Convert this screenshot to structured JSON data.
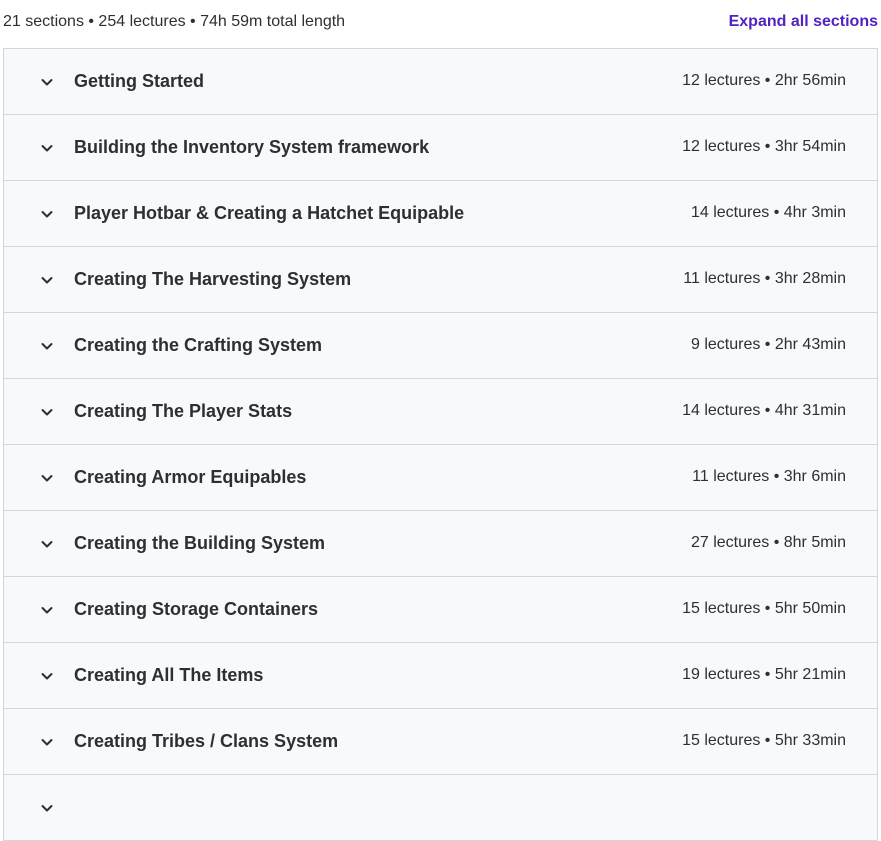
{
  "header": {
    "summary": "21 sections • 254 lectures • 74h 59m total length",
    "expand_all_label": "Expand all sections"
  },
  "sections": [
    {
      "title": "Getting Started",
      "meta": "12 lectures • 2hr 56min"
    },
    {
      "title": "Building the Inventory System framework",
      "meta": "12 lectures • 3hr 54min"
    },
    {
      "title": "Player Hotbar & Creating a Hatchet Equipable",
      "meta": "14 lectures • 4hr 3min"
    },
    {
      "title": "Creating The Harvesting System",
      "meta": "11 lectures • 3hr 28min"
    },
    {
      "title": "Creating the Crafting System",
      "meta": "9 lectures • 2hr 43min"
    },
    {
      "title": "Creating The Player Stats",
      "meta": "14 lectures • 4hr 31min"
    },
    {
      "title": "Creating Armor Equipables",
      "meta": "11 lectures • 3hr 6min"
    },
    {
      "title": "Creating the Building System",
      "meta": "27 lectures • 8hr 5min"
    },
    {
      "title": "Creating Storage Containers",
      "meta": "15 lectures • 5hr 50min"
    },
    {
      "title": "Creating All The Items",
      "meta": "19 lectures • 5hr 21min"
    },
    {
      "title": "Creating Tribes / Clans System",
      "meta": "15 lectures • 5hr 33min"
    },
    {
      "title": "",
      "meta": ""
    }
  ],
  "icons": {
    "chevron": "chevron-down-icon"
  },
  "colors": {
    "accent": "#5022c3",
    "section_bg": "#f7f9fa",
    "border": "#d1d7dc",
    "text": "#2d2f31"
  }
}
